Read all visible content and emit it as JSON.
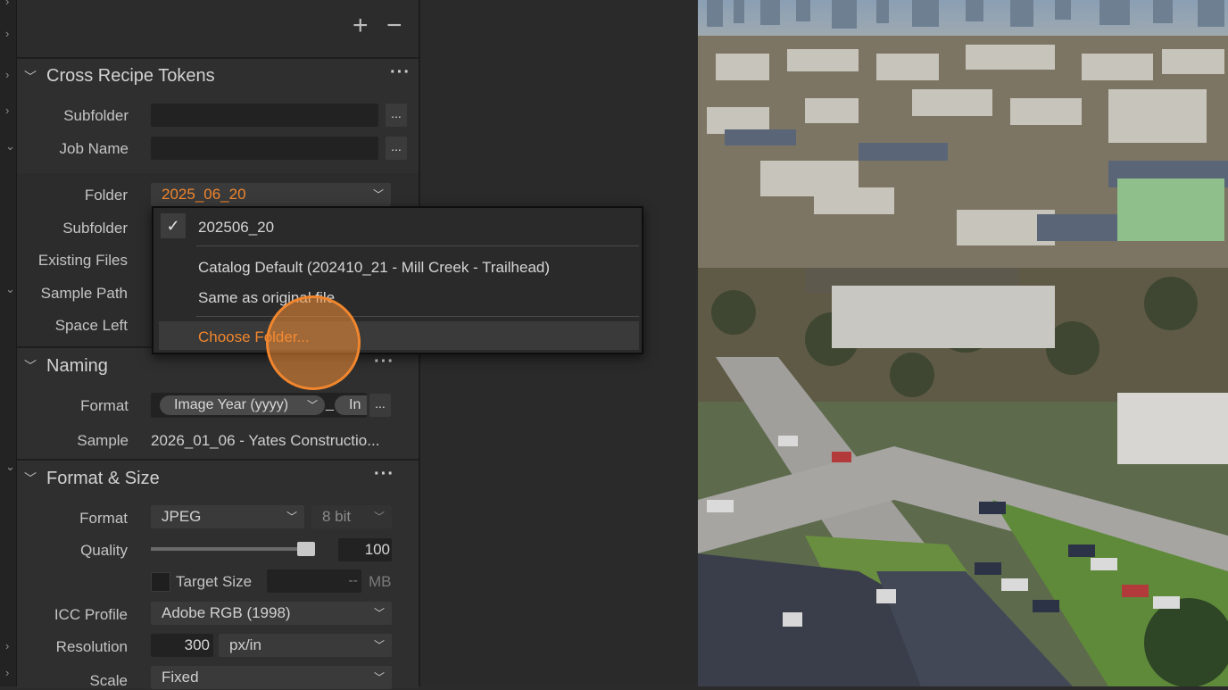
{
  "toolbar": {
    "add_label": "+",
    "remove_label": "−"
  },
  "cross_recipe": {
    "title": "Cross Recipe Tokens",
    "more": "···",
    "subfolder_label": "Subfolder",
    "jobname_label": "Job Name",
    "browse": "..."
  },
  "output": {
    "folder_label": "Folder",
    "folder_value": "2025_06_20",
    "subfolder_label": "Subfolder",
    "existing_label": "Existing Files",
    "sample_path_label": "Sample Path",
    "space_left_label": "Space Left"
  },
  "folder_dropdown": {
    "check": "✓",
    "items": [
      "202506_20",
      "Catalog Default (202410_21 - Mill Creek - Trailhead)",
      "Same as original file",
      "Choose Folder..."
    ]
  },
  "naming": {
    "title": "Naming",
    "more": "···",
    "format_label": "Format",
    "token1": "Image Year (yyyy)",
    "separator": "_",
    "token2": "In",
    "browse": "...",
    "sample_label": "Sample",
    "sample_value": "2026_01_06 - Yates Constructio..."
  },
  "format_size": {
    "title": "Format & Size",
    "more": "···",
    "format_label": "Format",
    "format_value": "JPEG",
    "bitdepth_value": "8 bit",
    "quality_label": "Quality",
    "quality_value": "100",
    "quality_level": 100,
    "target_size_label": "Target Size",
    "target_size_value": "--",
    "target_size_unit": "MB",
    "icc_label": "ICC Profile",
    "icc_value": "Adobe RGB (1998)",
    "resolution_label": "Resolution",
    "resolution_value": "300",
    "resolution_unit": "px/in",
    "scale_label": "Scale",
    "scale_value": "Fixed"
  },
  "colors": {
    "accent": "#f0862d",
    "panel": "#2c2c2c",
    "field": "#222222"
  }
}
